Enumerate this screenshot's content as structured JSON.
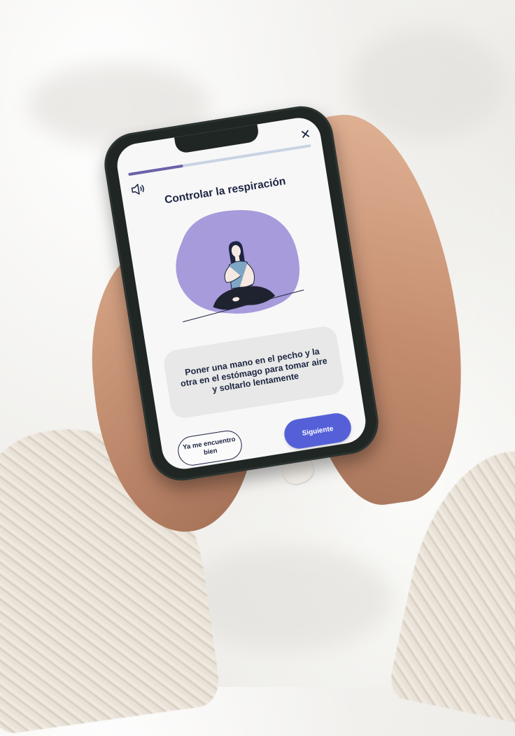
{
  "screen": {
    "progress_fraction": 0.3,
    "title": "Controlar la respiración",
    "description": "Poner una mano en el pecho y la otra en el estómago para tomar aire y soltarlo lentamente",
    "secondary_button": "Ya me encuentro bien",
    "primary_button": "Siguiente",
    "icons": {
      "sound": "speaker-icon",
      "close": "close-icon"
    }
  },
  "colors": {
    "accent": "#5560d8",
    "progress": "#6a62a8",
    "blob": "#a79bdb",
    "text_dark": "#1c2440"
  }
}
